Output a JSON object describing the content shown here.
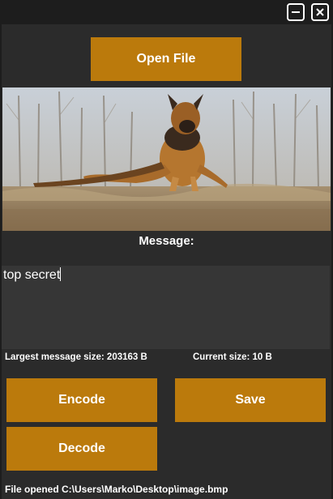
{
  "window": {
    "minimize_icon": "minimize-icon",
    "close_icon": "close-icon"
  },
  "actions": {
    "open_file": "Open File",
    "encode": "Encode",
    "save": "Save",
    "decode": "Decode"
  },
  "image": {
    "subject": "german-shepherd-dog-photo"
  },
  "message": {
    "label": "Message:",
    "value": "top secret"
  },
  "info": {
    "largest_size": "Largest message size: 203163 B",
    "current_size": "Current size: 10 B"
  },
  "status": {
    "text": "File opened C:\\Users\\Marko\\Desktop\\image.bmp"
  },
  "colors": {
    "accent": "#bb7a0c",
    "background": "#1d1d1d",
    "panel": "#2b2b2b",
    "text_area": "#363636"
  }
}
